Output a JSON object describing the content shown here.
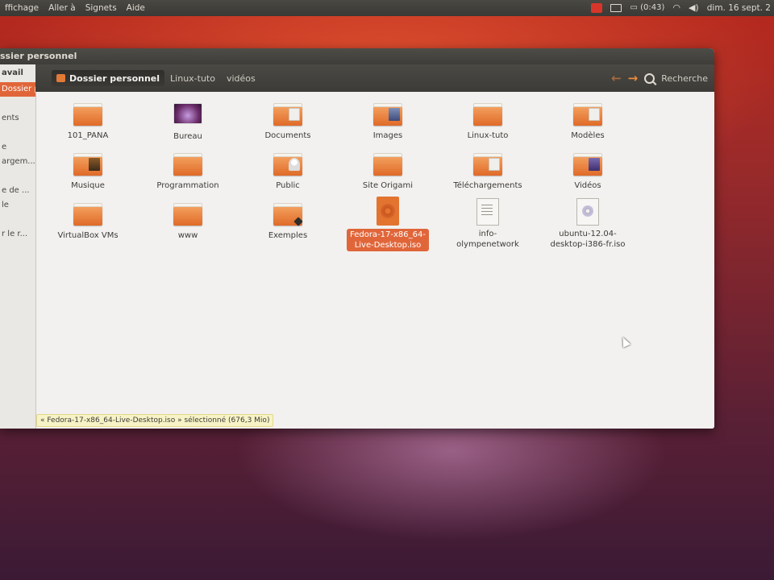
{
  "top_panel": {
    "menu": [
      "ffichage",
      "Aller à",
      "Signets",
      "Aide"
    ],
    "battery": "(0:43)",
    "clock": "dim. 16 sept. 2"
  },
  "window": {
    "title": "ssier personnel"
  },
  "sidebar": {
    "header": "avail",
    "items": [
      "Dossier pers...",
      "",
      "ents",
      "",
      "e",
      "argem...",
      "",
      "e de ...",
      "le",
      "",
      "r le r..."
    ],
    "active_index": 0
  },
  "toolbar": {
    "path": [
      "Dossier personnel",
      "Linux-tuto",
      "vidéos"
    ],
    "back_arrow": "←",
    "forward_arrow": "→",
    "search_label": "Recherche"
  },
  "files": [
    {
      "name": "101_PANA",
      "icon": "folder-icon"
    },
    {
      "name": "Bureau",
      "icon": "desktop-folder-icon"
    },
    {
      "name": "Documents",
      "icon": "documents-folder-icon"
    },
    {
      "name": "Images",
      "icon": "images-folder-icon"
    },
    {
      "name": "Linux-tuto",
      "icon": "folder-icon"
    },
    {
      "name": "Modèles",
      "icon": "templates-folder-icon"
    },
    {
      "name": "Musique",
      "icon": "music-folder-icon"
    },
    {
      "name": "Programmation",
      "icon": "folder-icon"
    },
    {
      "name": "Public",
      "icon": "public-folder-icon"
    },
    {
      "name": "Site Origami",
      "icon": "folder-icon"
    },
    {
      "name": "Téléchargements",
      "icon": "downloads-folder-icon"
    },
    {
      "name": "Vidéos",
      "icon": "videos-folder-icon"
    },
    {
      "name": "VirtualBox VMs",
      "icon": "folder-icon"
    },
    {
      "name": "www",
      "icon": "folder-icon"
    },
    {
      "name": "Exemples",
      "icon": "examples-folder-icon"
    },
    {
      "name": "Fedora-17-x86_64-Live-Desktop.iso",
      "label_line1": "Fedora-17-x86_64-",
      "label_line2": "Live-Desktop.iso",
      "icon": "iso-file-icon",
      "selected": true
    },
    {
      "name": "info-olympenetwork",
      "label_line1": "info-",
      "label_line2": "olympenetwork",
      "icon": "text-file-icon"
    },
    {
      "name": "ubuntu-12.04-desktop-i386-fr.iso",
      "label_line1": "ubuntu-12.04-",
      "label_line2": "desktop-i386-fr.iso",
      "icon": "disc-image-icon"
    }
  ],
  "status_bar": "« Fedora-17-x86_64-Live-Desktop.iso » sélectionné (676,3 Mio)",
  "colors": {
    "accent": "#e0663a",
    "folder": "#e88a3c",
    "panel": "#3c3b37"
  }
}
